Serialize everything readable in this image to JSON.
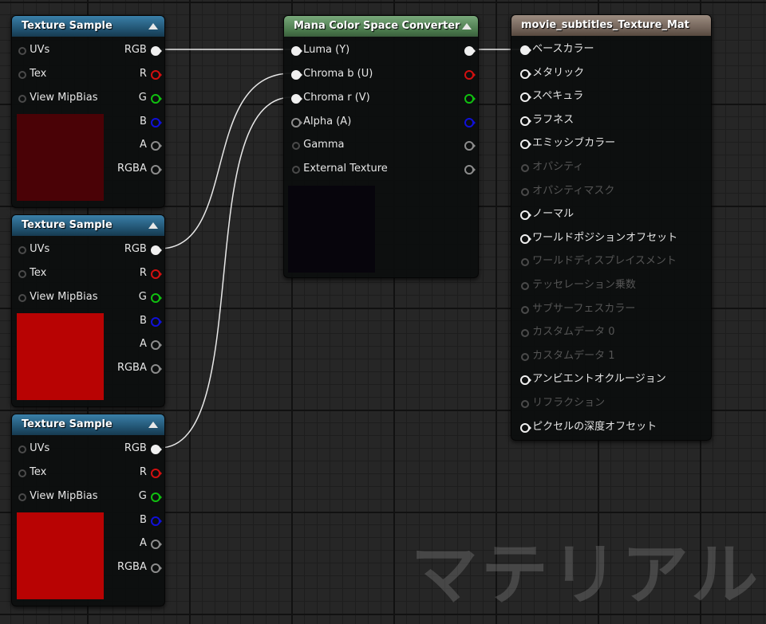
{
  "texture_nodes": [
    {
      "title": "Texture Sample",
      "inputs": [
        "UVs",
        "Tex",
        "View MipBias"
      ],
      "outputs": [
        "RGB",
        "R",
        "G",
        "B",
        "A",
        "RGBA"
      ],
      "preview_color": "#4a0206"
    },
    {
      "title": "Texture Sample",
      "inputs": [
        "UVs",
        "Tex",
        "View MipBias"
      ],
      "outputs": [
        "RGB",
        "R",
        "G",
        "B",
        "A",
        "RGBA"
      ],
      "preview_color": "#b80303"
    },
    {
      "title": "Texture Sample",
      "inputs": [
        "UVs",
        "Tex",
        "View MipBias"
      ],
      "outputs": [
        "RGB",
        "R",
        "G",
        "B",
        "A",
        "RGBA"
      ],
      "preview_color": "#b80303"
    }
  ],
  "mana_node": {
    "title": "Mana Color Space Converter",
    "inputs": [
      "Luma (Y)",
      "Chroma b (U)",
      "Chroma r (V)",
      "Alpha (A)",
      "Gamma",
      "External Texture"
    ],
    "preview_color": "#07050c"
  },
  "material_node": {
    "title": "movie_subtitles_Texture_Mat",
    "inputs": [
      {
        "label": "ベースカラー",
        "enabled": true
      },
      {
        "label": "メタリック",
        "enabled": true
      },
      {
        "label": "スペキュラ",
        "enabled": true
      },
      {
        "label": "ラフネス",
        "enabled": true
      },
      {
        "label": "エミッシブカラー",
        "enabled": true
      },
      {
        "label": "オパシティ",
        "enabled": false
      },
      {
        "label": "オパシティマスク",
        "enabled": false
      },
      {
        "label": "ノーマル",
        "enabled": true
      },
      {
        "label": "ワールドポジションオフセット",
        "enabled": true
      },
      {
        "label": "ワールドディスプレイスメント",
        "enabled": false
      },
      {
        "label": "テッセレーション乗数",
        "enabled": false
      },
      {
        "label": "サブサーフェスカラー",
        "enabled": false
      },
      {
        "label": "カスタムデータ 0",
        "enabled": false
      },
      {
        "label": "カスタムデータ 1",
        "enabled": false
      },
      {
        "label": "アンビエントオクルージョン",
        "enabled": true
      },
      {
        "label": "リフラクション",
        "enabled": false
      },
      {
        "label": "ピクセルの深度オフセット",
        "enabled": true
      }
    ]
  },
  "watermark": "マテリアル",
  "colors": {
    "pin_red": "#d21010",
    "pin_green": "#10c010",
    "pin_blue": "#1010d8",
    "wire": "#e8e8e8"
  }
}
